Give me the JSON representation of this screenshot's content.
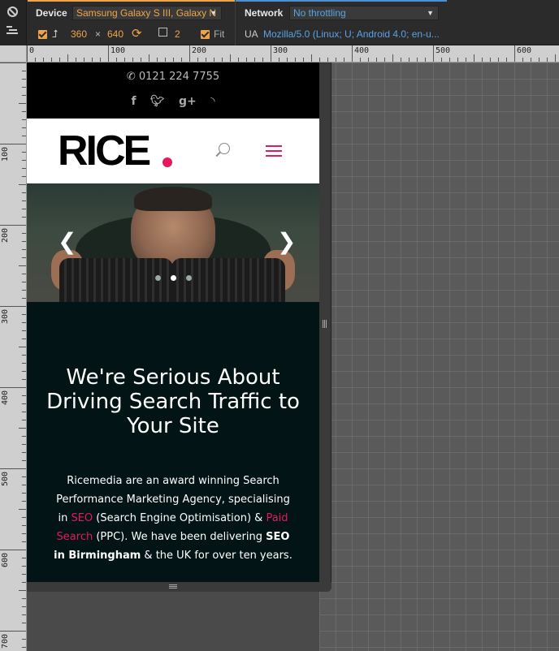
{
  "toolbar": {
    "device_label": "Device",
    "device_value": "Samsung Galaxy S III, Galaxy N",
    "width": "360",
    "times": "×",
    "height": "640",
    "zoom_value": "2",
    "fit_label": "Fit",
    "network_label": "Network",
    "network_value": "No throttling",
    "ua_label": "UA",
    "ua_value": "Mozilla/5.0 (Linux; U; Android 4.0; en-u..."
  },
  "ruler": {
    "top_labels": [
      "0",
      "100",
      "200",
      "300",
      "400",
      "500",
      "600"
    ],
    "left_labels": [
      "100",
      "200",
      "300",
      "400",
      "500",
      "600",
      "700"
    ]
  },
  "site": {
    "phone": "0121 224 7755",
    "social": [
      "f",
      "t",
      "g+",
      "rss"
    ],
    "logo": "RICE",
    "slider_prev": "‹",
    "slider_next": "›",
    "slides_active": 1,
    "headline": "We're Serious About Driving Search Traffic to Your Site",
    "para": {
      "p1": "Ricemedia are an award winning Search Performance Marketing Agency, specialising in ",
      "seo_link": "SEO",
      "p2": " (Search Engine Optimisation) & ",
      "paid_link": "Paid Search",
      "p3": " (PPC). We have been delivering ",
      "bold": "SEO in Birmingham",
      "p4": " & the UK for over ten years."
    }
  },
  "colors": {
    "accent_orange": "#f0a44a",
    "accent_blue": "#5aa2e6",
    "brand_pink": "#e5195b",
    "content_bg": "#031416"
  }
}
